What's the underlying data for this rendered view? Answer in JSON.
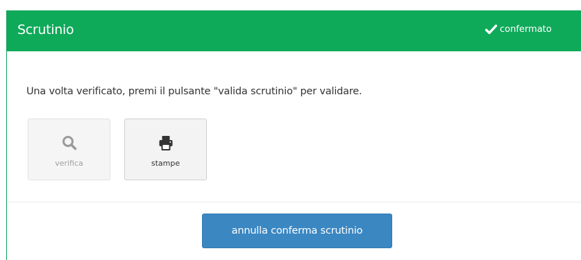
{
  "panel": {
    "title": "Scrutinio",
    "status": {
      "icon": "checkmark-icon",
      "text": "confermato"
    }
  },
  "body": {
    "instructions": "Una volta verificato, premi il pulsante \"valida scrutinio\" per validare.",
    "tools": {
      "verifica": {
        "label": "verifica",
        "icon": "search-icon",
        "enabled": false
      },
      "stampe": {
        "label": "stampe",
        "icon": "print-icon",
        "enabled": true
      }
    }
  },
  "footer": {
    "action_label": "annulla conferma scrutinio"
  },
  "colors": {
    "header_green": "#0fa95a",
    "primary_blue": "#3b87c2",
    "disabled_gray": "#a0a0a0"
  }
}
